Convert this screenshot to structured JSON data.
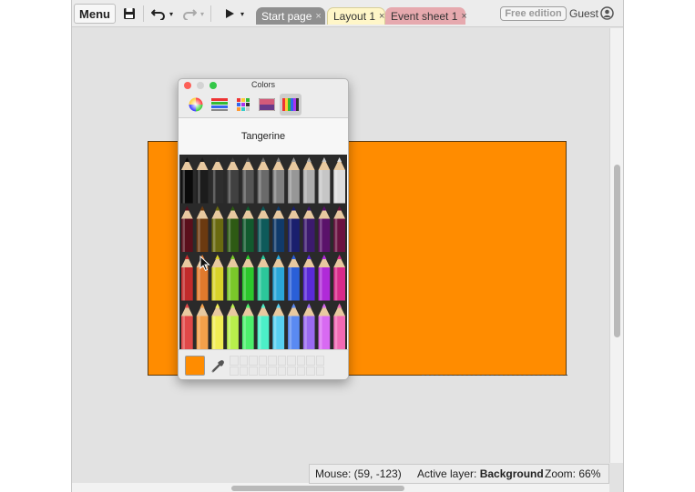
{
  "toolbar": {
    "menu_label": "Menu",
    "save_icon": "floppy-disk-icon",
    "undo_icon": "undo-icon",
    "redo_icon": "redo-icon",
    "play_icon": "play-icon",
    "dropdown_glyph": "▾"
  },
  "tabs": [
    {
      "label": "Start page",
      "close": "×",
      "active": false
    },
    {
      "label": "Layout 1",
      "close": "×",
      "active": true
    },
    {
      "label": "Event sheet 1",
      "close": "×",
      "active": false
    }
  ],
  "account": {
    "edition_badge": "Free edition",
    "user_label": "Guest",
    "user_icon": "user-circle-icon"
  },
  "layout": {
    "background_color": "#ff8c00"
  },
  "colors_panel": {
    "title": "Colors",
    "modes": [
      "color-wheel-icon",
      "color-sliders-icon",
      "color-palettes-icon",
      "image-palettes-icon",
      "pencils-icon"
    ],
    "active_mode": "pencils-icon",
    "selected_color_name": "Tangerine",
    "selected_color": "#ff8c00",
    "pencil_rows": [
      [
        "#0a0a0a",
        "#1c1c1c",
        "#2e2e2e",
        "#414141",
        "#555555",
        "#6a6a6a",
        "#808080",
        "#979797",
        "#aeaeae",
        "#c6c6c6",
        "#dedede"
      ],
      [
        "#5a0f1b",
        "#6b3a10",
        "#6a6a10",
        "#2e5a14",
        "#125a2e",
        "#0e5a5a",
        "#103a6a",
        "#1a1f6e",
        "#3c1a6e",
        "#5a126a",
        "#6a1240"
      ],
      [
        "#c22b2b",
        "#e07a2c",
        "#d9d32a",
        "#7ac72a",
        "#2cc72c",
        "#2cc79a",
        "#2aa6d8",
        "#2a5fd8",
        "#5a2ad8",
        "#b02ad8",
        "#d82a8a"
      ],
      [
        "#e04848",
        "#f4a04a",
        "#f1ed54",
        "#b8ef4c",
        "#4cef6c",
        "#4cefc8",
        "#58d0f2",
        "#5a8af2",
        "#9a6af2",
        "#d86af2",
        "#f26ab4"
      ]
    ]
  },
  "statusbar": {
    "mouse": "Mouse: (59, -123)",
    "active_layer_label": "Active layer:",
    "active_layer_value": "Background",
    "zoom": "Zoom: 66%"
  }
}
